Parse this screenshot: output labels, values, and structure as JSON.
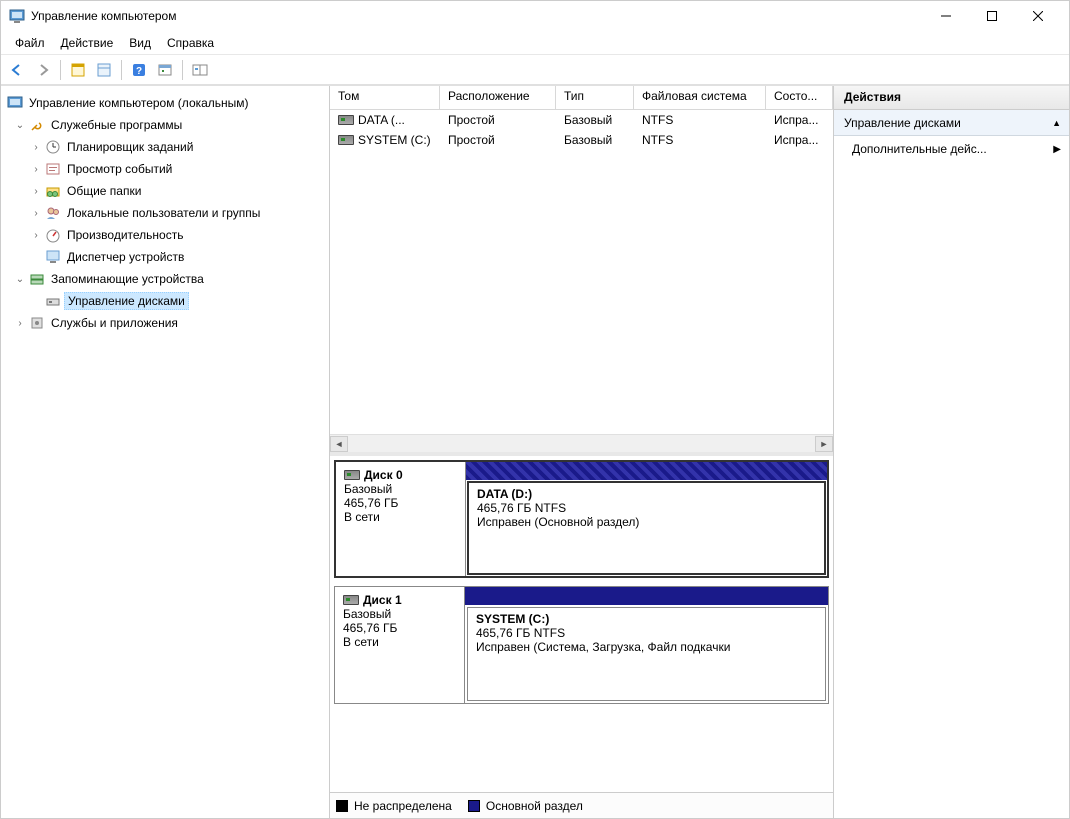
{
  "window": {
    "title": "Управление компьютером"
  },
  "menu": {
    "file": "Файл",
    "action": "Действие",
    "view": "Вид",
    "help": "Справка"
  },
  "tree": {
    "root": "Управление компьютером (локальным)",
    "n1": "Служебные программы",
    "n1a": "Планировщик заданий",
    "n1b": "Просмотр событий",
    "n1c": "Общие папки",
    "n1d": "Локальные пользователи и группы",
    "n1e": "Производительность",
    "n1f": "Диспетчер устройств",
    "n2": "Запоминающие устройства",
    "n2a": "Управление дисками",
    "n3": "Службы и приложения"
  },
  "cols": {
    "c0": "Том",
    "c1": "Расположение",
    "c2": "Тип",
    "c3": "Файловая система",
    "c4": "Состо..."
  },
  "rows": [
    {
      "vol": "DATA (...",
      "layout": "Простой",
      "type": "Базовый",
      "fs": "NTFS",
      "st": "Испра..."
    },
    {
      "vol": "SYSTEM (C:)",
      "layout": "Простой",
      "type": "Базовый",
      "fs": "NTFS",
      "st": "Испра..."
    }
  ],
  "disks": [
    {
      "name": "Диск 0",
      "dtype": "Базовый",
      "size": "465,76 ГБ",
      "status": "В сети",
      "part": {
        "title": "DATA  (D:)",
        "line2": "465,76 ГБ NTFS",
        "line3": "Исправен (Основной раздел)"
      },
      "selected": true
    },
    {
      "name": "Диск 1",
      "dtype": "Базовый",
      "size": "465,76 ГБ",
      "status": "В сети",
      "part": {
        "title": "SYSTEM  (C:)",
        "line2": "465,76 ГБ NTFS",
        "line3": "Исправен (Система, Загрузка, Файл подкачки"
      },
      "selected": false
    }
  ],
  "legend": {
    "unalloc": "Не распределена",
    "primary": "Основной раздел"
  },
  "actions": {
    "header": "Действия",
    "section": "Управление дисками",
    "item": "Дополнительные дейс..."
  }
}
